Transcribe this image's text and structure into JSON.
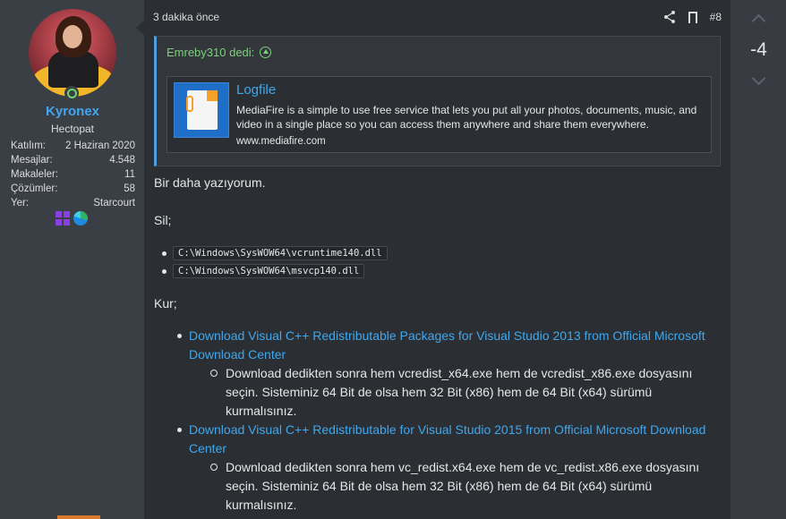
{
  "user": {
    "name": "Kyronex",
    "title": "Hectopat",
    "stats": [
      {
        "label": "Katılım:",
        "value": "2 Haziran 2020"
      },
      {
        "label": "Mesajlar:",
        "value": "4.548"
      },
      {
        "label": "Makaleler:",
        "value": "11"
      },
      {
        "label": "Çözümler:",
        "value": "58"
      },
      {
        "label": "Yer:",
        "value": "Starcourt"
      }
    ],
    "badges": [
      "windows-icon",
      "edge-icon"
    ],
    "status_color": "#6dd36d"
  },
  "post": {
    "time": "3 dakika önce",
    "number": "#8",
    "quote": {
      "author": "Emreby310 dedi:",
      "embed": {
        "title": "Logfile",
        "description": "MediaFire is a simple to use free service that lets you put all your photos, documents, music, and video in a single place so you can access them anywhere and share them everywhere.",
        "url": "www.mediafire.com"
      }
    },
    "para1": "Bir daha yazıyorum.",
    "para2": "Sil;",
    "code_items": [
      "C:\\Windows\\SysWOW64\\vcruntime140.dll",
      "C:\\Windows\\SysWOW64\\msvcp140.dll"
    ],
    "para3": "Kur;",
    "links": [
      {
        "text": "Download Visual C++ Redistributable Packages for Visual Studio 2013 from Official Microsoft Download Center",
        "note": "Download dedikten sonra hem vcredist_x64.exe hem de vcredist_x86.exe dosyasını seçin. Sisteminiz 64 Bit de olsa hem 32 Bit (x86) hem de 64 Bit (x64) sürümü kurmalısınız."
      },
      {
        "text": "Download Visual C++ Redistributable for Visual Studio 2015 from Official Microsoft Download Center",
        "note": "Download dedikten sonra hem vc_redist.x64.exe hem de vc_redist.x86.exe dosyasını seçin. Sisteminiz 64 Bit de olsa hem 32 Bit (x86) hem de 64 Bit (x64) sürümü kurmalısınız."
      }
    ]
  },
  "vote": {
    "score": "-4"
  },
  "colors": {
    "accent": "#3fa7ee",
    "quote_author": "#7bd17b",
    "background": "#2b2f33",
    "panel": "#3a3f46"
  }
}
